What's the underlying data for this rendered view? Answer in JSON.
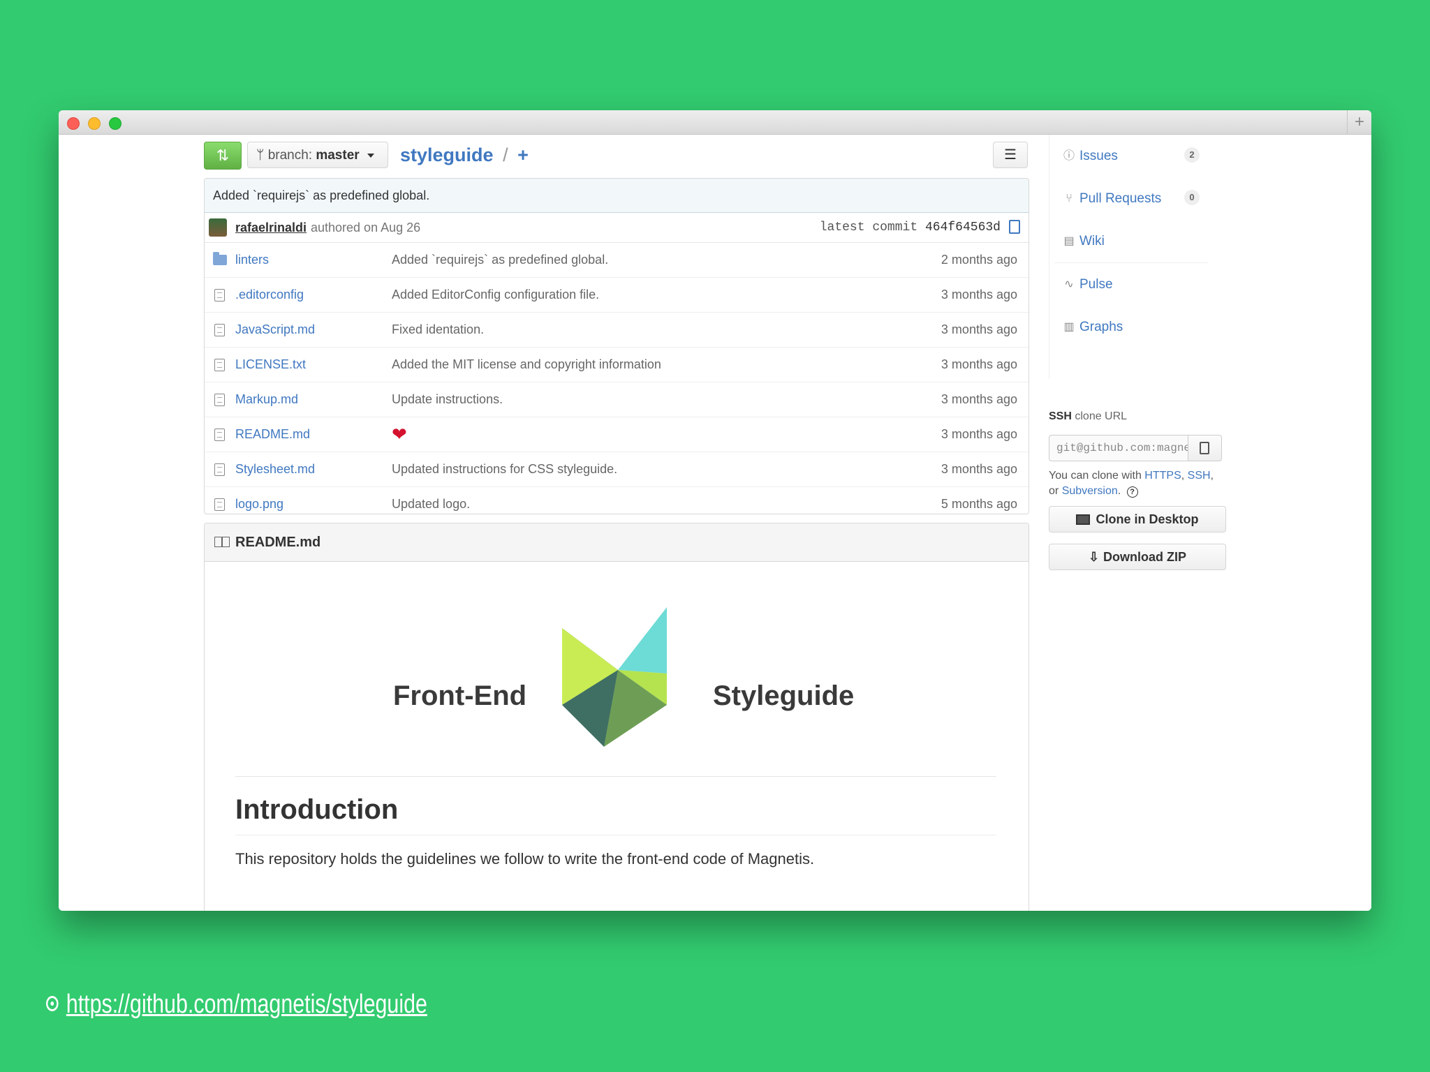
{
  "repo": {
    "branch_label": "branch:",
    "branch_name": "master",
    "name": "styleguide",
    "separator": "/",
    "add": "+"
  },
  "commit": {
    "message": "Added `requirejs` as predefined global.",
    "author": "rafaelrinaldi",
    "authored": "authored on Aug 26",
    "latest_label": "latest commit",
    "sha": "464f64563d"
  },
  "files": [
    {
      "name": "linters",
      "type": "folder",
      "message": "Added `requirejs` as predefined global.",
      "age": "2 months ago"
    },
    {
      "name": ".editorconfig",
      "type": "file",
      "message": "Added EditorConfig configuration file.",
      "age": "3 months ago"
    },
    {
      "name": "JavaScript.md",
      "type": "file",
      "message": "Fixed identation.",
      "age": "3 months ago"
    },
    {
      "name": "LICENSE.txt",
      "type": "file",
      "message": "Added the MIT license and copyright information",
      "age": "3 months ago"
    },
    {
      "name": "Markup.md",
      "type": "file",
      "message": "Update instructions.",
      "age": "3 months ago"
    },
    {
      "name": "README.md",
      "type": "file",
      "message": "❤",
      "age": "3 months ago"
    },
    {
      "name": "Stylesheet.md",
      "type": "file",
      "message": "Updated instructions for CSS styleguide.",
      "age": "3 months ago"
    },
    {
      "name": "logo.png",
      "type": "file",
      "message": "Updated logo.",
      "age": "5 months ago"
    }
  ],
  "readme": {
    "title": "README.md",
    "logo_left": "Front-End",
    "logo_right": "Styleguide",
    "heading": "Introduction",
    "paragraph": "This repository holds the guidelines we follow to write the front-end code of Magnetis."
  },
  "sidebar": {
    "issues_label": "Issues",
    "issues_count": "2",
    "pulls_label": "Pull Requests",
    "pulls_count": "0",
    "wiki_label": "Wiki",
    "pulse_label": "Pulse",
    "graphs_label": "Graphs",
    "ssh_bold": "SSH",
    "ssh_rest": "clone URL",
    "clone_url": "git@github.com:magnetis/styleguide.git",
    "clone_help_prefix": "You can clone with",
    "https": "HTTPS",
    "ssh": "SSH",
    "or": "or",
    "subversion": "Subversion",
    "clone_desktop": "Clone in Desktop",
    "download_zip": "Download ZIP"
  },
  "footer": {
    "url": "https://github.com/magnetis/styleguide"
  },
  "colors": {
    "background": "#32cb6f",
    "link": "#4078c0",
    "compare_button": "#60b044"
  }
}
